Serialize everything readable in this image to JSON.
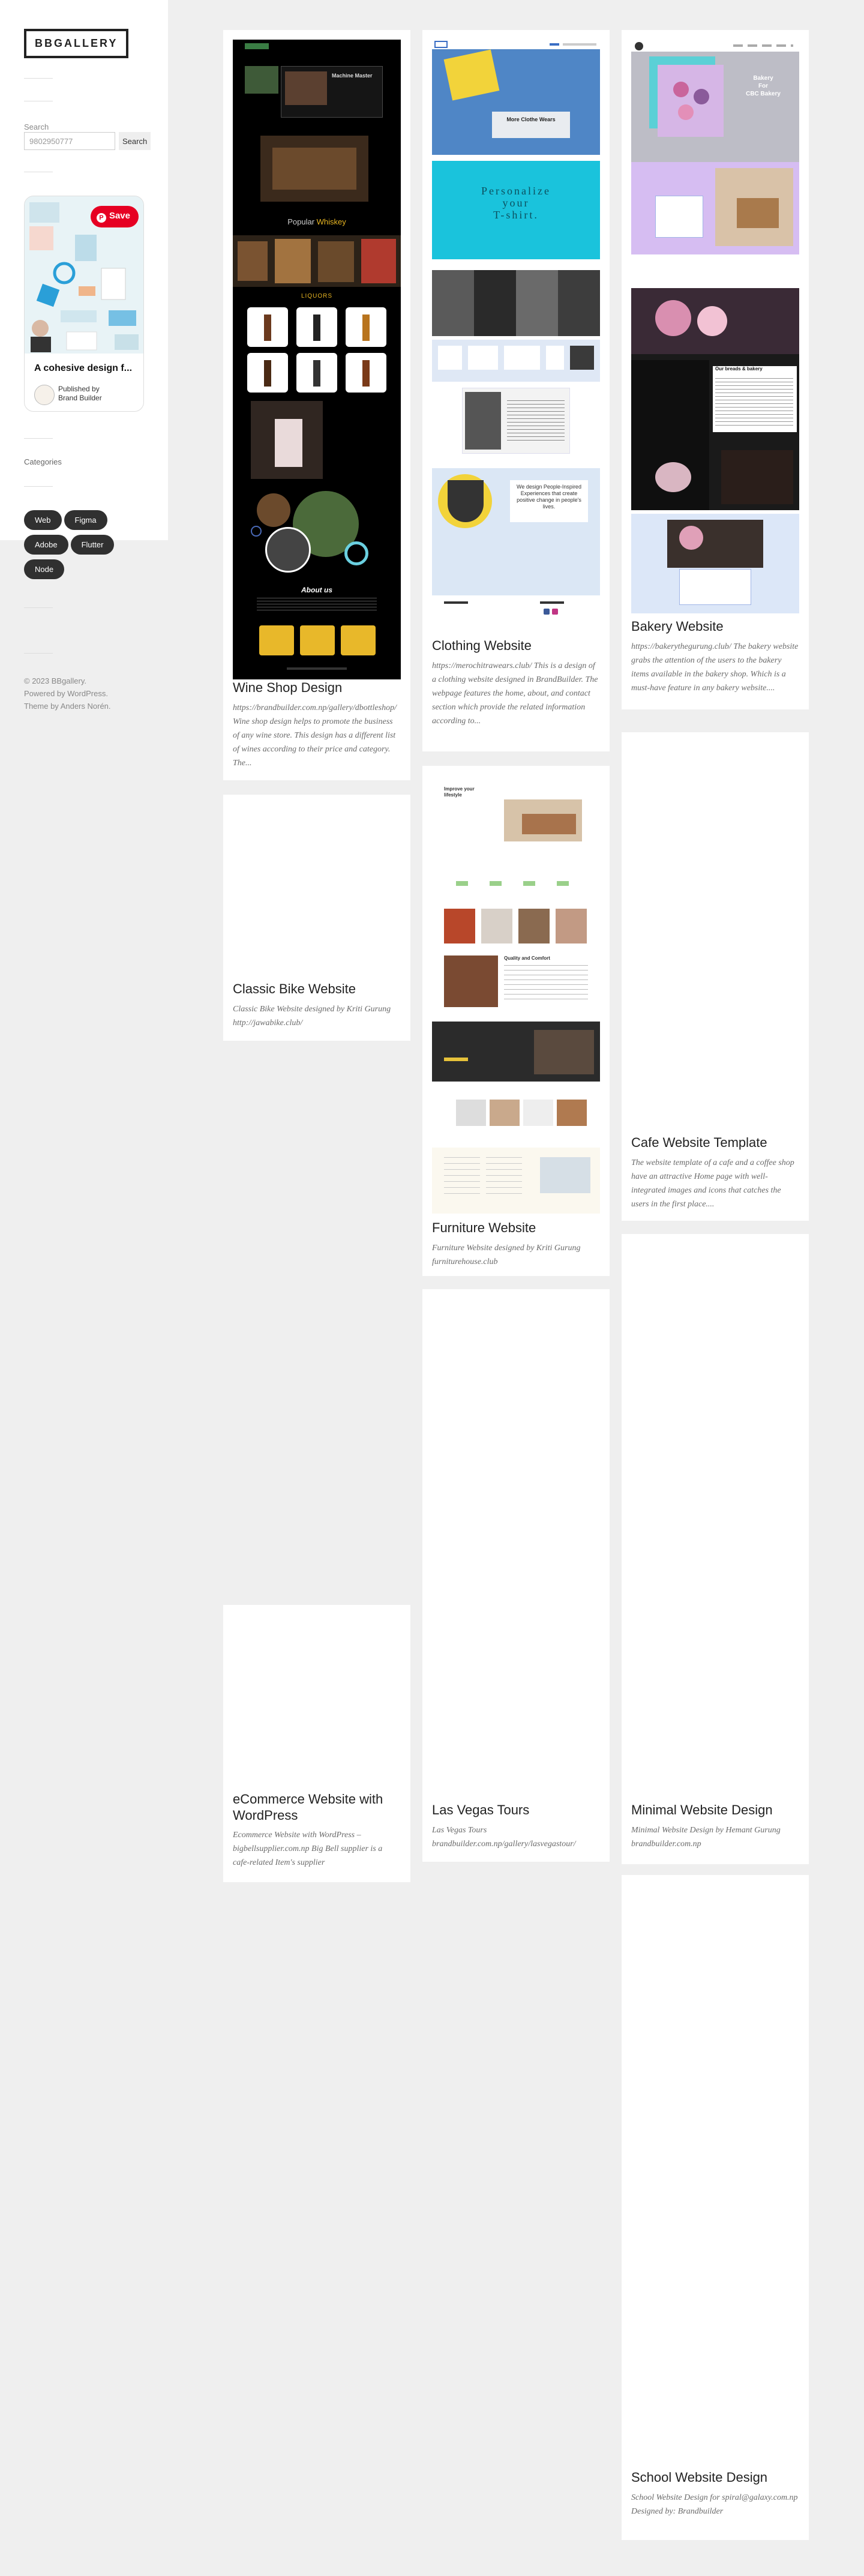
{
  "site": {
    "title": "BBGALLERY"
  },
  "search": {
    "label": "Search",
    "value": "9802950777",
    "button_label": "Search"
  },
  "pin": {
    "save_label": "Save",
    "title": "A cohesive design f...",
    "publisher_line1": "Published by",
    "publisher_line2": "Brand Builder"
  },
  "categories": {
    "label": "Categories",
    "tags": [
      "Web",
      "Figma",
      "Adobe",
      "Flutter",
      "Node"
    ]
  },
  "footer": {
    "line1": "© 2023 BBgallery.",
    "line2": "Powered by WordPress.",
    "line3": "Theme by Anders Norén."
  },
  "posts": [
    {
      "title": "Wine Shop Design",
      "excerpt": "https://brandbuilder.com.np/gallery/dbottleshop/ Wine shop design helps to promote the business of any wine store. This design has a different list of wines according to their price and category. The..."
    },
    {
      "title": "Clothing Website",
      "excerpt": "https://merochitrawears.club/ This is a design of a clothing website designed in BrandBuilder. The webpage features the home, about, and contact section which provide the related information according to..."
    },
    {
      "title": "Bakery Website",
      "excerpt": "https://bakerythegurung.club/ The bakery website grabs the attention of the users to the bakery items available in the bakery shop. Which is a must-have feature in any bakery website...."
    },
    {
      "title": "Classic Bike Website",
      "excerpt": "Classic Bike Website designed by Kriti Gurung http://jawabike.club/"
    },
    {
      "title": "Furniture Website",
      "excerpt": "Furniture Website designed by Kriti Gurung furniturehouse.club"
    },
    {
      "title": "Cafe Website Template",
      "excerpt": "The website template of a cafe and a coffee shop have an attractive Home page with well-integrated images and icons that catches the users in the first place...."
    },
    {
      "title": "eCommerce Website with WordPress",
      "excerpt": "Ecommerce Website with WordPress – bigbellsupplier.com.np Big Bell supplier is a cafe-related Item's supplier"
    },
    {
      "title": "Las Vegas Tours",
      "excerpt": "Las Vegas Tours brandbuilder.com.np/gallery/lasvegastour/"
    },
    {
      "title": "Minimal Website Design",
      "excerpt": "Minimal Website Design by Hemant Gurung brandbuilder.com.np"
    },
    {
      "title": "School Website Design",
      "excerpt": "School Website Design for spiral@galaxy.com.np Designed by: Brandbuilder"
    }
  ],
  "thumb_text": {
    "wine": {
      "banner": "Machine Master",
      "popular_prefix": "Popular",
      "popular_highlight": "Whiskey",
      "liquors": "LIQUORS",
      "about": "About us"
    },
    "clothing": {
      "hero": "More Clothe Wears",
      "tshirt_line1": "Personalize",
      "tshirt_line2": "your",
      "tshirt_line3": "T-shirt.",
      "quote": "We design People-Inspired Experiences that create positive change in people's lives."
    },
    "bakery": {
      "hero_line1": "Bakery",
      "hero_line2": "For",
      "hero_line3": "CBC Bakery",
      "treats": "Our breads & bakery"
    },
    "furniture": {
      "hero": "Improve your lifestyle",
      "quality": "Quality and Comfort"
    }
  }
}
